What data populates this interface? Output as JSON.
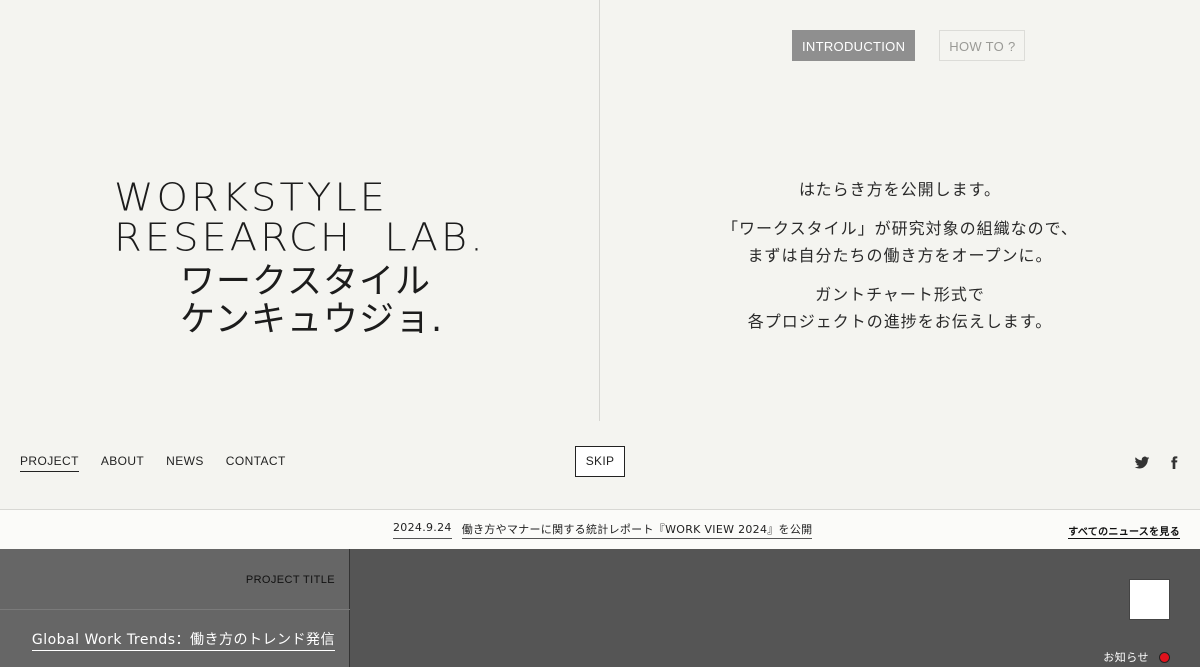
{
  "logo": {
    "en_line1": "WORKSTYLE",
    "en_line2": "RESEARCH  LAB.",
    "jp_line1": "ワークスタイル",
    "jp_line2": "ケンキュウジョ."
  },
  "mode_tabs": [
    {
      "label": "INTRODUCTION",
      "active": true
    },
    {
      "label": "HOW TO ?",
      "active": false
    }
  ],
  "intro": {
    "p1_line1": "はたらき方を公開します。",
    "p2_line1": "「ワークスタイル」が研究対象の組織なので、",
    "p2_line2": "まずは自分たちの働き方をオープンに。",
    "p3_line1": "ガントチャート形式で",
    "p3_line2": "各プロジェクトの進捗をお伝えします。"
  },
  "nav": {
    "items": [
      {
        "label": "PROJECT",
        "current": true
      },
      {
        "label": "ABOUT",
        "current": false
      },
      {
        "label": "NEWS",
        "current": false
      },
      {
        "label": "CONTACT",
        "current": false
      }
    ]
  },
  "skip_label": "SKIP",
  "social": {
    "icons": [
      "twitter-icon",
      "facebook-icon"
    ]
  },
  "news": {
    "date": "2024.9.24",
    "headline": "働き方やマナーに関する統計レポート『WORK VIEW 2024』を公開",
    "all_link": "すべてのニュースを見る"
  },
  "project": {
    "title_label": "PROJECT TITLE",
    "name": "Global Work Trends：働き方のトレンド発信"
  },
  "notice": {
    "label": "お知らせ",
    "dot_color": "#e1121c"
  },
  "colors": {
    "background": "#f4f4f0",
    "active_tab": "#8f8f8f",
    "panel_dark": "#555555",
    "panel_mid": "#666666"
  }
}
